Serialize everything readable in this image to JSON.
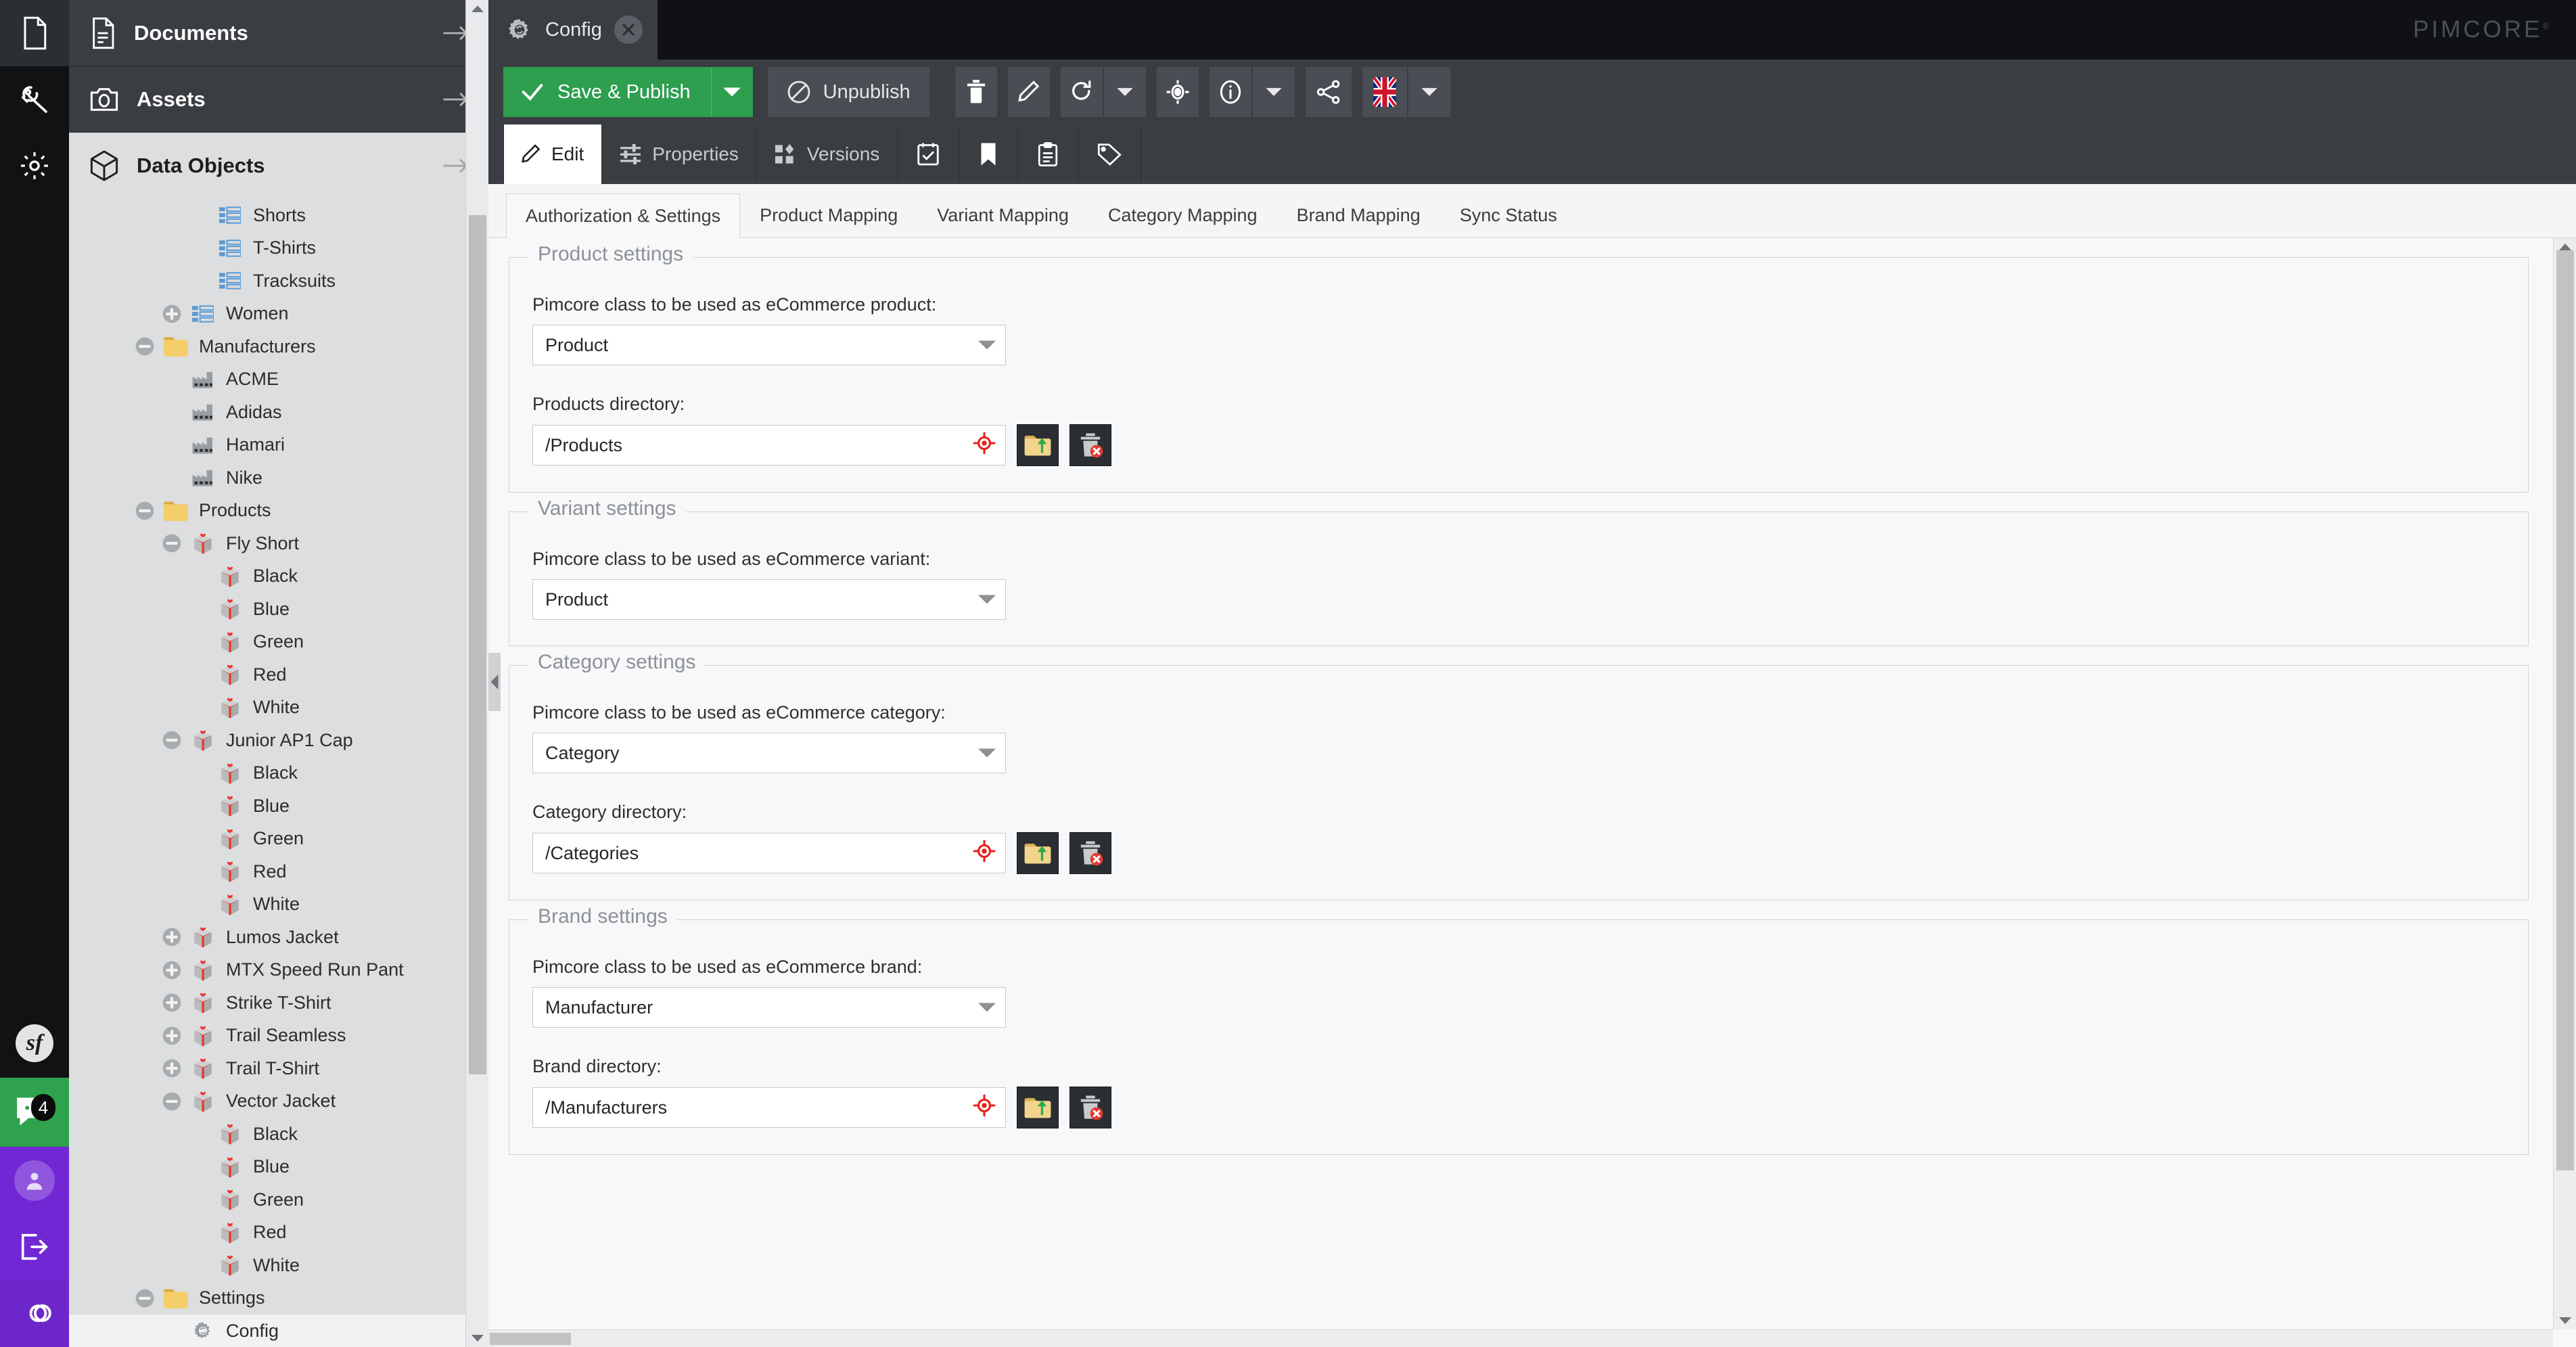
{
  "rail": {
    "items": [
      {
        "name": "documents",
        "icon": "document-icon"
      },
      {
        "name": "assets",
        "icon": "wrench-icon"
      },
      {
        "name": "settings",
        "icon": "gear-icon"
      }
    ],
    "symfony_label": "sf",
    "notification_count": "4"
  },
  "nav": {
    "items": [
      {
        "label": "Documents",
        "icon": "document-icon",
        "selected": false
      },
      {
        "label": "Assets",
        "icon": "camera-icon",
        "selected": false
      },
      {
        "label": "Data Objects",
        "icon": "cube-icon",
        "selected": true
      }
    ]
  },
  "tree": {
    "nodes": [
      {
        "label": "Shorts",
        "indent": 4,
        "expander": "none",
        "icon": "list-icon",
        "selected": false
      },
      {
        "label": "T-Shirts",
        "indent": 4,
        "expander": "none",
        "icon": "list-icon",
        "selected": false
      },
      {
        "label": "Tracksuits",
        "indent": 4,
        "expander": "none",
        "icon": "list-icon",
        "selected": false
      },
      {
        "label": "Women",
        "indent": 3,
        "expander": "plus",
        "icon": "list-icon",
        "selected": false
      },
      {
        "label": "Manufacturers",
        "indent": 2,
        "expander": "minus",
        "icon": "folder-icon",
        "selected": false
      },
      {
        "label": "ACME",
        "indent": 3,
        "expander": "none",
        "icon": "factory-icon",
        "selected": false
      },
      {
        "label": "Adidas",
        "indent": 3,
        "expander": "none",
        "icon": "factory-icon",
        "selected": false
      },
      {
        "label": "Hamari",
        "indent": 3,
        "expander": "none",
        "icon": "factory-icon",
        "selected": false
      },
      {
        "label": "Nike",
        "indent": 3,
        "expander": "none",
        "icon": "factory-icon",
        "selected": false
      },
      {
        "label": "Products",
        "indent": 2,
        "expander": "minus",
        "icon": "folder-icon",
        "selected": false
      },
      {
        "label": "Fly Short",
        "indent": 3,
        "expander": "minus",
        "icon": "product-icon",
        "selected": false
      },
      {
        "label": "Black",
        "indent": 4,
        "expander": "none",
        "icon": "product-icon",
        "selected": false
      },
      {
        "label": "Blue",
        "indent": 4,
        "expander": "none",
        "icon": "product-icon",
        "selected": false
      },
      {
        "label": "Green",
        "indent": 4,
        "expander": "none",
        "icon": "product-icon",
        "selected": false
      },
      {
        "label": "Red",
        "indent": 4,
        "expander": "none",
        "icon": "product-icon",
        "selected": false
      },
      {
        "label": "White",
        "indent": 4,
        "expander": "none",
        "icon": "product-icon",
        "selected": false
      },
      {
        "label": "Junior AP1 Cap",
        "indent": 3,
        "expander": "minus",
        "icon": "product-icon",
        "selected": false
      },
      {
        "label": "Black",
        "indent": 4,
        "expander": "none",
        "icon": "product-icon",
        "selected": false
      },
      {
        "label": "Blue",
        "indent": 4,
        "expander": "none",
        "icon": "product-icon",
        "selected": false
      },
      {
        "label": "Green",
        "indent": 4,
        "expander": "none",
        "icon": "product-icon",
        "selected": false
      },
      {
        "label": "Red",
        "indent": 4,
        "expander": "none",
        "icon": "product-icon",
        "selected": false
      },
      {
        "label": "White",
        "indent": 4,
        "expander": "none",
        "icon": "product-icon",
        "selected": false
      },
      {
        "label": "Lumos Jacket",
        "indent": 3,
        "expander": "plus",
        "icon": "product-icon",
        "selected": false
      },
      {
        "label": "MTX Speed Run Pant",
        "indent": 3,
        "expander": "plus",
        "icon": "product-icon",
        "selected": false
      },
      {
        "label": "Strike T-Shirt",
        "indent": 3,
        "expander": "plus",
        "icon": "product-icon",
        "selected": false
      },
      {
        "label": "Trail Seamless",
        "indent": 3,
        "expander": "plus",
        "icon": "product-icon",
        "selected": false
      },
      {
        "label": "Trail T-Shirt",
        "indent": 3,
        "expander": "plus",
        "icon": "product-icon",
        "selected": false
      },
      {
        "label": "Vector Jacket",
        "indent": 3,
        "expander": "minus",
        "icon": "product-icon",
        "selected": false
      },
      {
        "label": "Black",
        "indent": 4,
        "expander": "none",
        "icon": "product-icon",
        "selected": false
      },
      {
        "label": "Blue",
        "indent": 4,
        "expander": "none",
        "icon": "product-icon",
        "selected": false
      },
      {
        "label": "Green",
        "indent": 4,
        "expander": "none",
        "icon": "product-icon",
        "selected": false
      },
      {
        "label": "Red",
        "indent": 4,
        "expander": "none",
        "icon": "product-icon",
        "selected": false
      },
      {
        "label": "White",
        "indent": 4,
        "expander": "none",
        "icon": "product-icon",
        "selected": false
      },
      {
        "label": "Settings",
        "indent": 2,
        "expander": "minus",
        "icon": "folder-icon",
        "selected": false
      },
      {
        "label": "Config",
        "indent": 3,
        "expander": "none",
        "icon": "config-gear-icon",
        "selected": true
      }
    ]
  },
  "topbar": {
    "tab_label": "Config",
    "tab_icon": "config-gear-icon",
    "close_icon": "close-icon",
    "brand": "PIMCORE"
  },
  "toolbar": {
    "save_label": "Save & Publish",
    "save_color": "#2e9e4f",
    "save_split_icon": "chevron-down-icon",
    "unpublish_label": "Unpublish",
    "unpublish_icon": "no-entry-icon",
    "icons": [
      "trash-icon",
      "pencil-icon",
      "reload-icon",
      "chevron-down-icon",
      "target-icon",
      "info-icon",
      "chevron-down-icon",
      "share-icon",
      "flag-gb-icon",
      "chevron-down-icon"
    ]
  },
  "subtabs": {
    "items": [
      {
        "label": "Edit",
        "icon": "pencil-icon",
        "active": true
      },
      {
        "label": "Properties",
        "icon": "sliders-icon",
        "active": false
      },
      {
        "label": "Versions",
        "icon": "versions-icon",
        "active": false
      },
      {
        "label": "",
        "icon": "schedule-icon",
        "active": false
      },
      {
        "label": "",
        "icon": "bookmark-icon",
        "active": false
      },
      {
        "label": "",
        "icon": "notes-icon",
        "active": false
      },
      {
        "label": "",
        "icon": "tag-icon",
        "active": false
      }
    ]
  },
  "innertabs": {
    "items": [
      {
        "label": "Authorization & Settings",
        "active": true
      },
      {
        "label": "Product Mapping",
        "active": false
      },
      {
        "label": "Variant Mapping",
        "active": false
      },
      {
        "label": "Category Mapping",
        "active": false
      },
      {
        "label": "Brand Mapping",
        "active": false
      },
      {
        "label": "Sync Status",
        "active": false
      }
    ]
  },
  "form": {
    "sections": [
      {
        "legend": "Product settings",
        "class_label": "Pimcore class to be used as eCommerce product:",
        "class_value": "Product",
        "dir_label": "Products directory:",
        "dir_value": "/Products",
        "has_dir": true
      },
      {
        "legend": "Variant settings",
        "class_label": "Pimcore class to be used as eCommerce variant:",
        "class_value": "Product",
        "dir_label": "",
        "dir_value": "",
        "has_dir": false
      },
      {
        "legend": "Category settings",
        "class_label": "Pimcore class to be used as eCommerce category:",
        "class_value": "Category",
        "dir_label": "Category directory:",
        "dir_value": "/Categories",
        "has_dir": true
      },
      {
        "legend": "Brand settings",
        "class_label": "Pimcore class to be used as eCommerce brand:",
        "class_value": "Manufacturer",
        "dir_label": "Brand directory:",
        "dir_value": "/Manufacturers",
        "has_dir": true
      }
    ],
    "dir_icons": {
      "target": "target-red-icon",
      "browse": "folder-upload-icon",
      "clear": "trash-delete-icon"
    }
  }
}
